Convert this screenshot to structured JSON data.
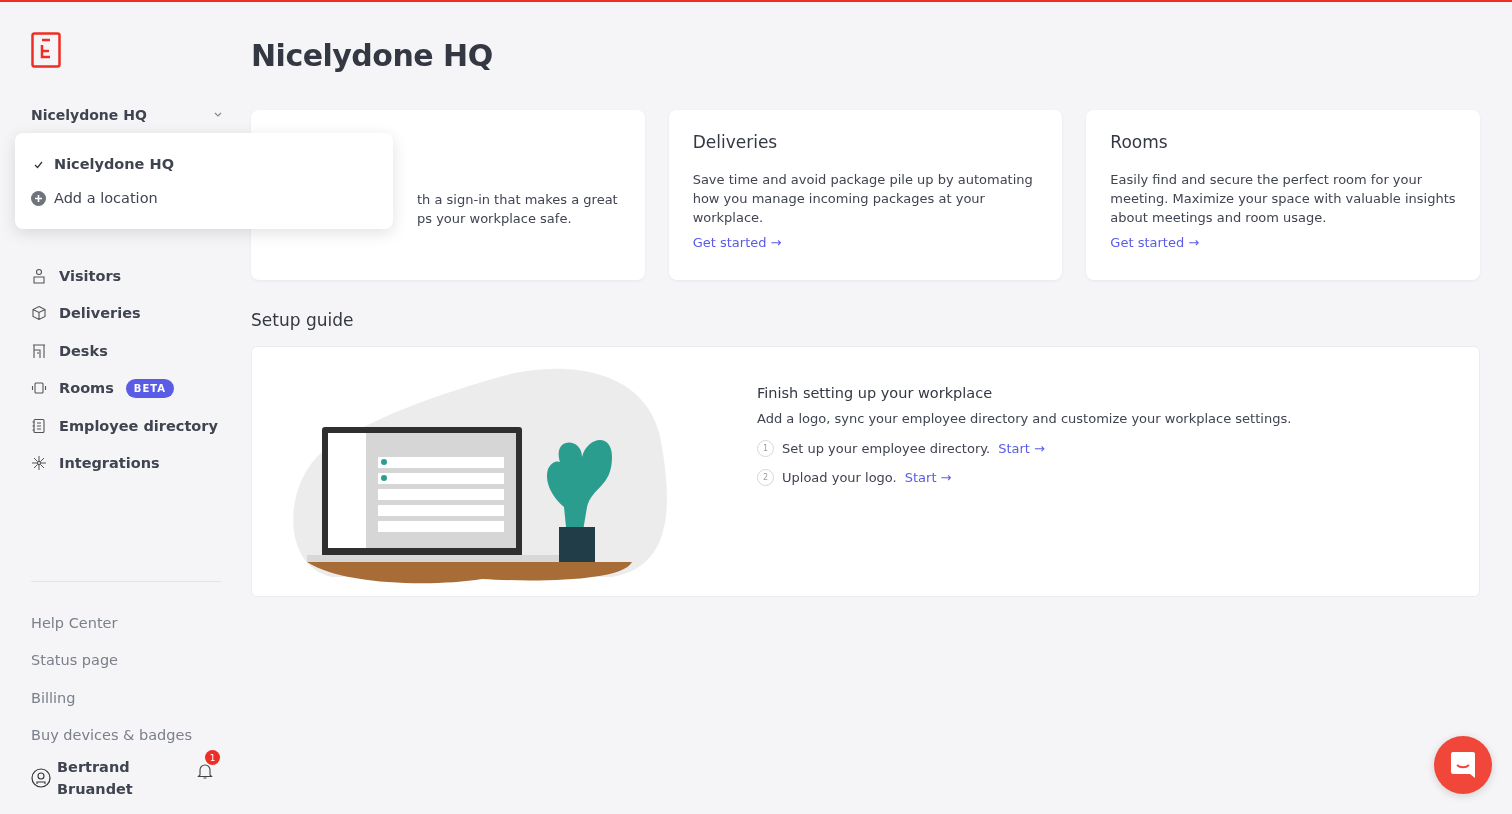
{
  "location_selector": {
    "label": "Nicelydone HQ",
    "expanded": true
  },
  "location_menu": {
    "items": [
      {
        "kind": "location",
        "label": "Nicelydone HQ",
        "selected": true
      },
      {
        "kind": "add",
        "label": "Add a location",
        "selected": false
      }
    ]
  },
  "nav": {
    "items": [
      {
        "label": "Visitors"
      },
      {
        "label": "Deliveries"
      },
      {
        "label": "Desks"
      },
      {
        "label": "Rooms",
        "badge": "BETA"
      },
      {
        "label": "Employee directory"
      },
      {
        "label": "Integrations"
      }
    ]
  },
  "footer_links": [
    "Help Center",
    "Status page",
    "Billing",
    "Buy devices & badges"
  ],
  "user": {
    "name": "Bertrand Bruandet",
    "notifications": "1"
  },
  "page_title": "Nicelydone HQ",
  "cards": [
    {
      "description_lines": [
        "th a sign-in that makes a great",
        "ps your workplace safe."
      ]
    },
    {
      "title": "Deliveries",
      "description": "Save time and avoid package pile up by automating how you manage incoming packages at your workplace.",
      "link": "Get started →"
    },
    {
      "title": "Rooms",
      "description": "Easily find and secure the perfect room for your meeting. Maximize your space with valuable insights about meetings and room usage.",
      "link": "Get started →"
    }
  ],
  "setup_guide": {
    "heading": "Setup guide",
    "title": "Finish setting up your workplace",
    "description": "Add a logo, sync your employee directory and customize your workplace settings.",
    "steps": [
      {
        "number": "1",
        "text": "Set up your employee directory.",
        "link": "Start →"
      },
      {
        "number": "2",
        "text": "Upload your logo.",
        "link": "Start →"
      }
    ]
  }
}
